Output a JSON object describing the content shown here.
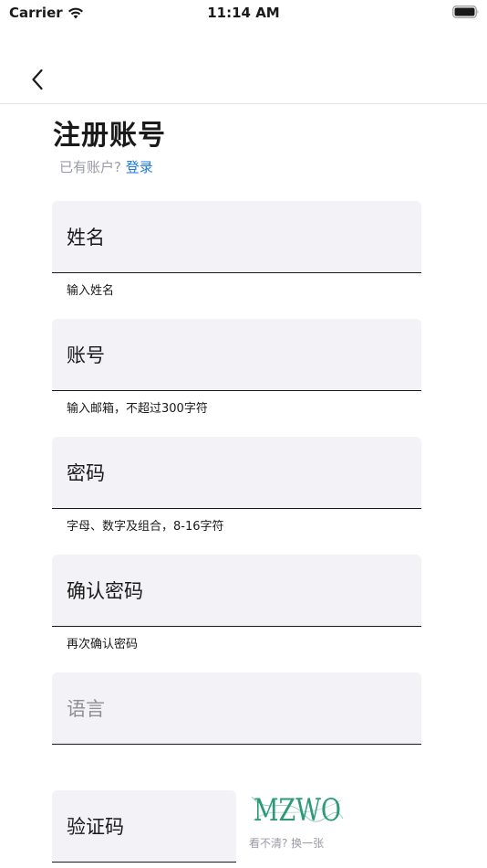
{
  "status_bar": {
    "carrier": "Carrier",
    "time": "11:14 AM"
  },
  "nav": {
    "back_icon": "chevron-left-icon"
  },
  "page": {
    "title": "注册账号",
    "login_prompt": "已有账户?",
    "login_link": "登录"
  },
  "fields": {
    "name": {
      "label": "姓名",
      "helper": "输入姓名"
    },
    "account": {
      "label": "账号",
      "helper": "输入邮箱，不超过300字符"
    },
    "password": {
      "label": "密码",
      "helper": "字母、数字及组合，8-16字符"
    },
    "confirm_password": {
      "label": "确认密码",
      "helper": "再次确认密码"
    },
    "language": {
      "placeholder": "语言"
    },
    "captcha": {
      "label": "验证码"
    }
  },
  "captcha": {
    "image_text": "MZWO",
    "refresh_text": "看不清? 换一张"
  },
  "colors": {
    "accent": "#1f7ae0",
    "field_bg": "#f2f2f7",
    "muted": "#9a9aa8",
    "captcha_green": "#2a9a78"
  }
}
